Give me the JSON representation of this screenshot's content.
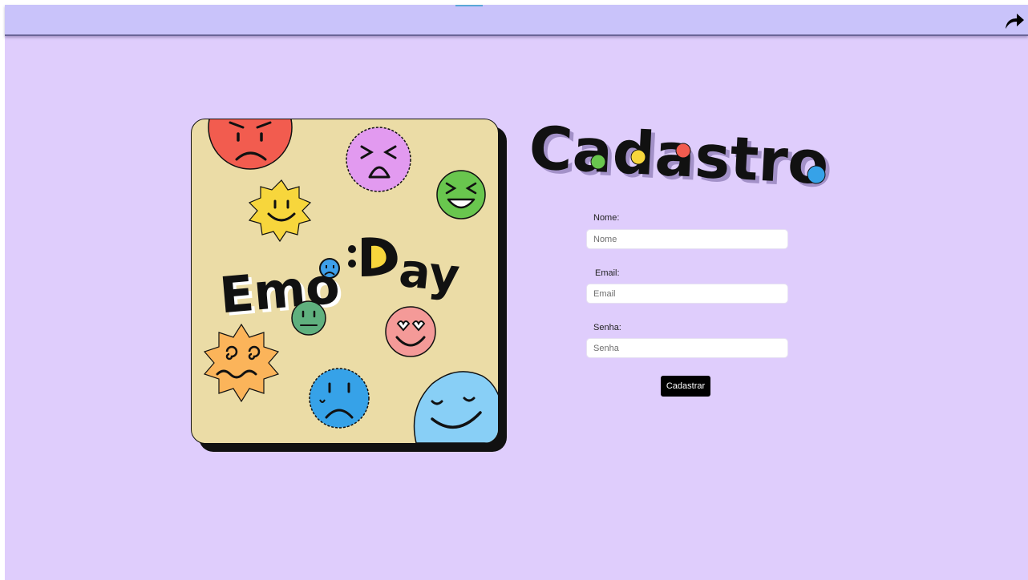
{
  "colors": {
    "page_background": "#dfcdfc",
    "topbar_background": "#c9c3fa",
    "button_background": "#000000",
    "button_text": "#ffffff"
  },
  "header": {
    "share_icon": "share-arrow-icon"
  },
  "cover": {
    "logo_text": "Emo:Day",
    "icons": [
      "angry-face-icon",
      "squint-face-icon",
      "laughing-face-icon",
      "smiling-sun-icon",
      "neutral-face-icon",
      "heart-eyes-face-icon",
      "dizzy-face-icon",
      "sad-face-icon",
      "content-face-icon"
    ]
  },
  "title": {
    "text": "Cadastro"
  },
  "form": {
    "name": {
      "label": "Nome:",
      "placeholder": "Nome"
    },
    "email": {
      "label": "Email:",
      "placeholder": "Email"
    },
    "password": {
      "label": "Senha:",
      "placeholder": "Senha"
    },
    "submit_label": "Cadastrar"
  }
}
